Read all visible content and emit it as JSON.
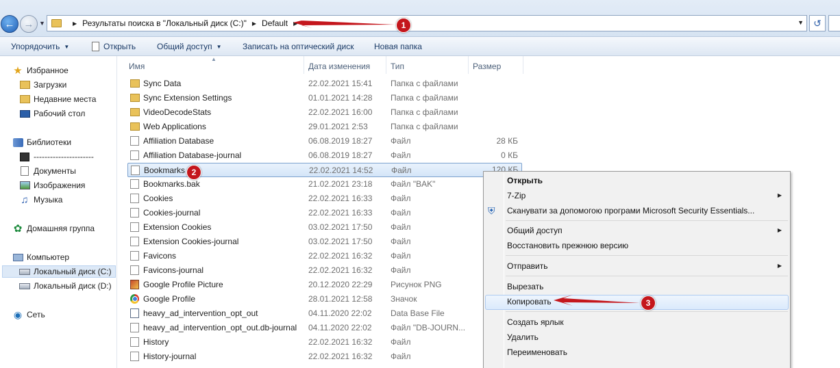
{
  "address": {
    "crumbs": [
      "Результаты поиска в \"Локальный диск (C:)\"",
      "Default"
    ]
  },
  "toolbar": {
    "organize": "Упорядочить",
    "open": "Открыть",
    "share": "Общий доступ",
    "burn": "Записать на оптический диск",
    "new_folder": "Новая папка"
  },
  "nav": {
    "favorites": "Избранное",
    "downloads": "Загрузки",
    "recent": "Недавние места",
    "desktop": "Рабочий стол",
    "libraries": "Библиотеки",
    "video": "----------------------",
    "documents": "Документы",
    "images": "Изображения",
    "music": "Музыка",
    "homegroup": "Домашняя группа",
    "computer": "Компьютер",
    "disk_c": "Локальный диск (C:)",
    "disk_d": "Локальный диск (D:)",
    "network": "Сеть"
  },
  "columns": {
    "name": "Имя",
    "date": "Дата изменения",
    "type": "Тип",
    "size": "Размер"
  },
  "files": [
    {
      "name": "Sync Data",
      "date": "22.02.2021 15:41",
      "type": "Папка с файлами",
      "size": "",
      "icon": "folder"
    },
    {
      "name": "Sync Extension Settings",
      "date": "01.01.2021 14:28",
      "type": "Папка с файлами",
      "size": "",
      "icon": "folder"
    },
    {
      "name": "VideoDecodeStats",
      "date": "22.02.2021 16:00",
      "type": "Папка с файлами",
      "size": "",
      "icon": "folder"
    },
    {
      "name": "Web Applications",
      "date": "29.01.2021 2:53",
      "type": "Папка с файлами",
      "size": "",
      "icon": "folder"
    },
    {
      "name": "Affiliation Database",
      "date": "06.08.2019 18:27",
      "type": "Файл",
      "size": "28 КБ",
      "icon": "file"
    },
    {
      "name": "Affiliation Database-journal",
      "date": "06.08.2019 18:27",
      "type": "Файл",
      "size": "0 КБ",
      "icon": "file"
    },
    {
      "name": "Bookmarks",
      "date": "22.02.2021 14:52",
      "type": "Файл",
      "size": "",
      "icon": "file"
    },
    {
      "name": "Bookmarks.bak",
      "date": "21.02.2021 23:18",
      "type": "Файл \"BAK\"",
      "size": "",
      "icon": "file"
    },
    {
      "name": "Cookies",
      "date": "22.02.2021 16:33",
      "type": "Файл",
      "size": "",
      "icon": "file"
    },
    {
      "name": "Cookies-journal",
      "date": "22.02.2021 16:33",
      "type": "Файл",
      "size": "",
      "icon": "file"
    },
    {
      "name": "Extension Cookies",
      "date": "03.02.2021 17:50",
      "type": "Файл",
      "size": "",
      "icon": "file"
    },
    {
      "name": "Extension Cookies-journal",
      "date": "03.02.2021 17:50",
      "type": "Файл",
      "size": "",
      "icon": "file"
    },
    {
      "name": "Favicons",
      "date": "22.02.2021 16:32",
      "type": "Файл",
      "size": "",
      "icon": "file"
    },
    {
      "name": "Favicons-journal",
      "date": "22.02.2021 16:32",
      "type": "Файл",
      "size": "",
      "icon": "file"
    },
    {
      "name": "Google Profile Picture",
      "date": "20.12.2020 22:29",
      "type": "Рисунок PNG",
      "size": "",
      "icon": "png"
    },
    {
      "name": "Google Profile",
      "date": "28.01.2021 12:58",
      "type": "Значок",
      "size": "",
      "icon": "chrome"
    },
    {
      "name": "heavy_ad_intervention_opt_out",
      "date": "04.11.2020 22:02",
      "type": "Data Base File",
      "size": "",
      "icon": "db"
    },
    {
      "name": "heavy_ad_intervention_opt_out.db-journal",
      "date": "04.11.2020 22:02",
      "type": "Файл \"DB-JOURN...",
      "size": "",
      "icon": "file"
    },
    {
      "name": "History",
      "date": "22.02.2021 16:32",
      "type": "Файл",
      "size": "",
      "icon": "file"
    },
    {
      "name": "History-journal",
      "date": "22.02.2021 16:32",
      "type": "Файл",
      "size": "",
      "icon": "file"
    }
  ],
  "context_menu": {
    "open": "Открыть",
    "zip": "7-Zip",
    "scan": "Сканувати за допомогою програми Microsoft Security Essentials...",
    "share": "Общий доступ",
    "restore": "Восстановить прежнюю версию",
    "send": "Отправить",
    "cut": "Вырезать",
    "copy": "Копировать",
    "shortcut": "Создать ярлык",
    "delete": "Удалить",
    "rename": "Переименовать"
  },
  "partial_size": "120 КБ",
  "annotations": [
    "1",
    "2",
    "3"
  ],
  "colors": {
    "annotation": "#c4161c",
    "selection": "#d4e5f8",
    "link_text": "#1a3a66"
  }
}
